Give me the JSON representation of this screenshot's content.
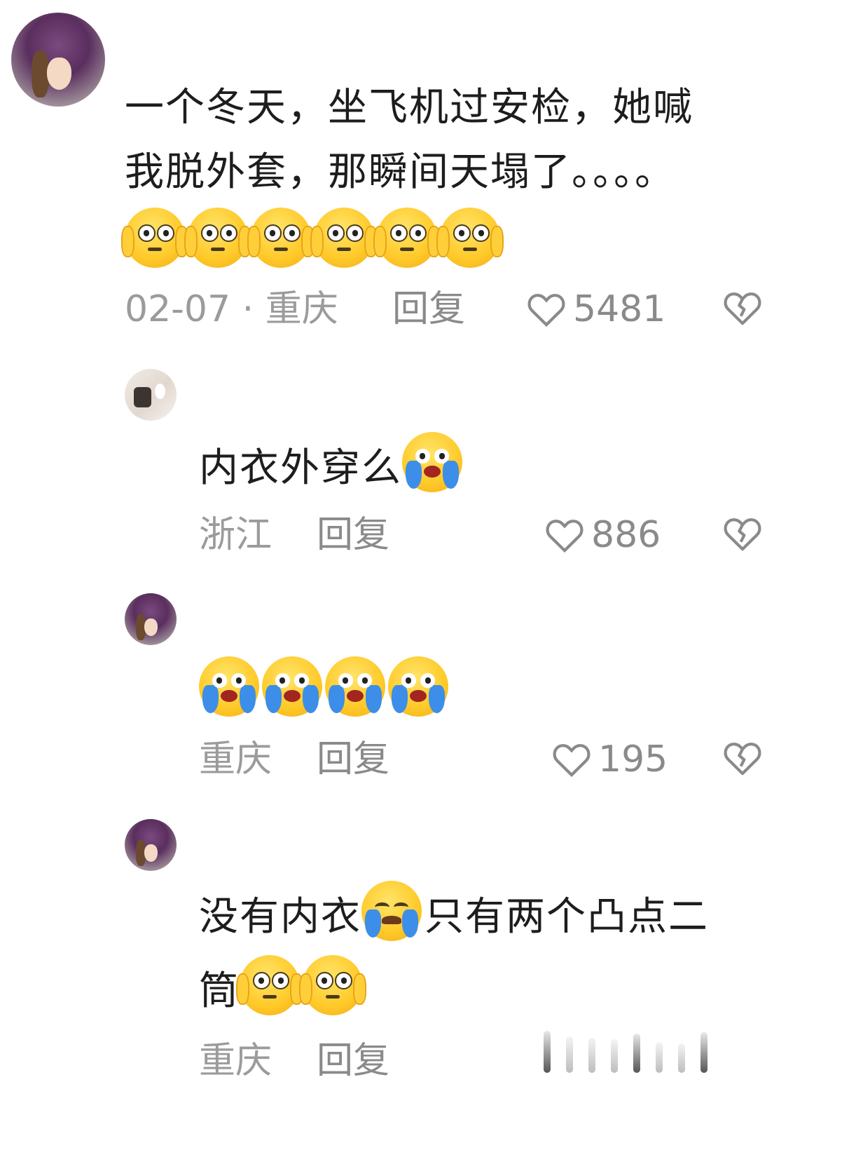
{
  "comments": [
    {
      "text_line1": "一个冬天，坐飞机过安检，她喊",
      "text_line2": "我脱外套，那瞬间天塌了。。。。",
      "date": "02-07",
      "location": "重庆",
      "reply_label": "回复",
      "likes": "5481",
      "emoji": [
        "peek-eyes-emoji",
        "peek-eyes-emoji",
        "peek-eyes-emoji",
        "peek-eyes-emoji",
        "peek-eyes-emoji",
        "peek-eyes-emoji"
      ]
    },
    {
      "text": "内衣外穿么",
      "location": "浙江",
      "reply_label": "回复",
      "likes": "886",
      "emoji": [
        "crying-laugh-emoji"
      ]
    },
    {
      "location": "重庆",
      "reply_label": "回复",
      "likes": "195",
      "emoji": [
        "crying-laugh-emoji",
        "crying-laugh-emoji",
        "crying-laugh-emoji",
        "crying-laugh-emoji"
      ]
    },
    {
      "text_part1": "没有内衣",
      "text_part2": "只有两个凸点二",
      "text_line2": "筒",
      "location": "重庆",
      "reply_label": "回复",
      "emoji": [
        "sobbing-emoji",
        "peek-eyes-emoji",
        "peek-eyes-emoji"
      ]
    }
  ],
  "colors": {
    "meta": "#9b9b9b",
    "text": "#1d1d1d",
    "emoji": "#ffc928",
    "tear": "#3c8ee8"
  }
}
